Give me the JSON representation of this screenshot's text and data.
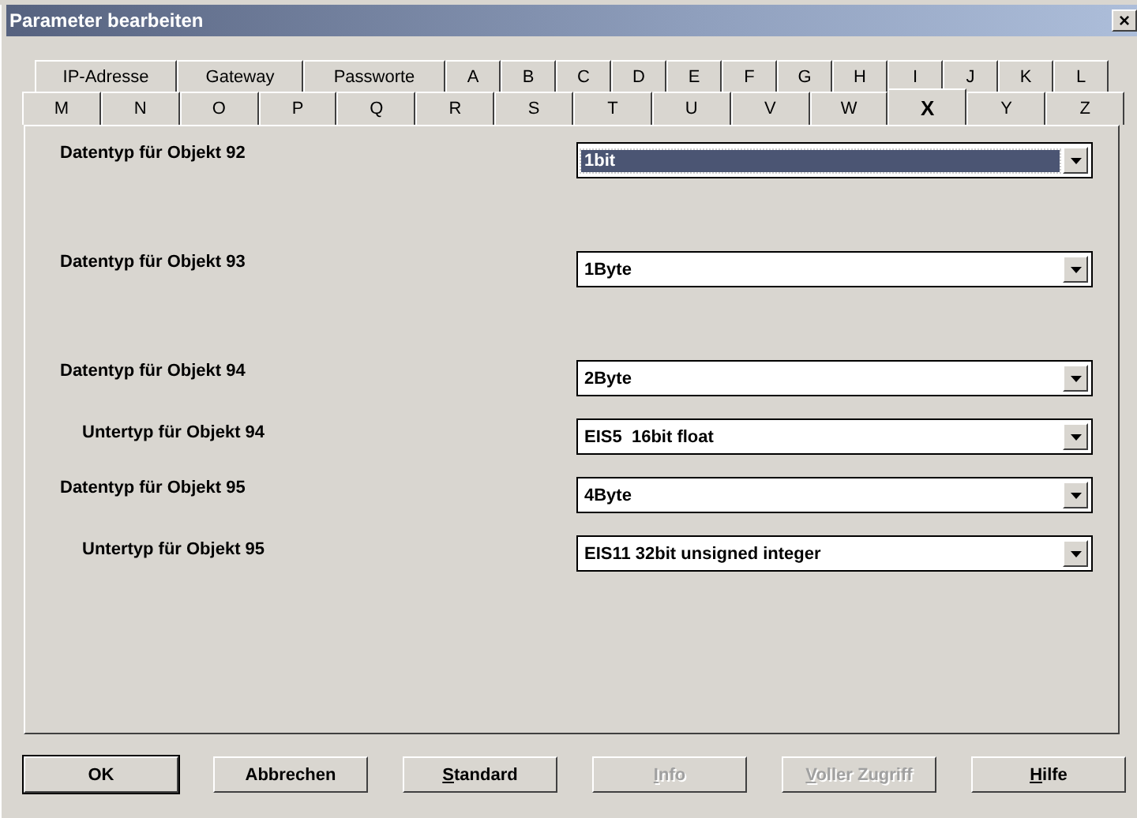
{
  "window": {
    "title": "Parameter bearbeiten",
    "close": "×"
  },
  "tab_rows": [
    {
      "tabs": [
        {
          "label": "IP-Adresse",
          "selected": false
        },
        {
          "label": "Gateway",
          "selected": false
        },
        {
          "label": "Passworte",
          "selected": false
        },
        {
          "label": "A",
          "selected": false
        },
        {
          "label": "B",
          "selected": false
        },
        {
          "label": "C",
          "selected": false
        },
        {
          "label": "D",
          "selected": false
        },
        {
          "label": "E",
          "selected": false
        },
        {
          "label": "F",
          "selected": false
        },
        {
          "label": "G",
          "selected": false
        },
        {
          "label": "H",
          "selected": false
        },
        {
          "label": "I",
          "selected": false
        },
        {
          "label": "J",
          "selected": false
        },
        {
          "label": "K",
          "selected": false
        },
        {
          "label": "L",
          "selected": false
        }
      ]
    },
    {
      "tabs": [
        {
          "label": "M",
          "selected": false
        },
        {
          "label": "N",
          "selected": false
        },
        {
          "label": "O",
          "selected": false
        },
        {
          "label": "P",
          "selected": false
        },
        {
          "label": "Q",
          "selected": false
        },
        {
          "label": "R",
          "selected": false
        },
        {
          "label": "S",
          "selected": false
        },
        {
          "label": "T",
          "selected": false
        },
        {
          "label": "U",
          "selected": false
        },
        {
          "label": "V",
          "selected": false
        },
        {
          "label": "W",
          "selected": false
        },
        {
          "label": "X",
          "selected": true
        },
        {
          "label": "Y",
          "selected": false
        },
        {
          "label": "Z",
          "selected": false
        }
      ]
    }
  ],
  "groups": [
    {
      "rows": [
        {
          "kind": "datatype",
          "label": "Datentyp für Objekt 92",
          "value": "1bit",
          "focused": true
        }
      ]
    },
    {
      "rows": [
        {
          "kind": "datatype",
          "label": "Datentyp für Objekt 93",
          "value": "1Byte",
          "focused": false
        }
      ]
    },
    {
      "rows": [
        {
          "kind": "datatype",
          "label": "Datentyp für Objekt 94",
          "value": "2Byte",
          "focused": false
        },
        {
          "kind": "subtype",
          "label": "Untertyp für Objekt 94",
          "value": "EIS5  16bit float",
          "focused": false
        },
        {
          "kind": "datatype",
          "label": "Datentyp für Objekt 95",
          "value": "4Byte",
          "focused": false
        },
        {
          "kind": "subtype",
          "label": "Untertyp für Objekt 95",
          "value": "EIS11 32bit unsigned integer",
          "focused": false
        }
      ]
    }
  ],
  "buttons": [
    {
      "label": "OK",
      "default": true,
      "disabled": false
    },
    {
      "label": "Abbrechen",
      "default": false,
      "disabled": false
    },
    {
      "mnemonic": "S",
      "rest": "tandard",
      "default": false,
      "disabled": false
    },
    {
      "mnemonic": "I",
      "rest": "nfo",
      "default": false,
      "disabled": true
    },
    {
      "mnemonic": "V",
      "rest": "oller Zugriff",
      "default": false,
      "disabled": true
    },
    {
      "mnemonic": "H",
      "rest": "ilfe",
      "default": false,
      "disabled": false
    }
  ]
}
